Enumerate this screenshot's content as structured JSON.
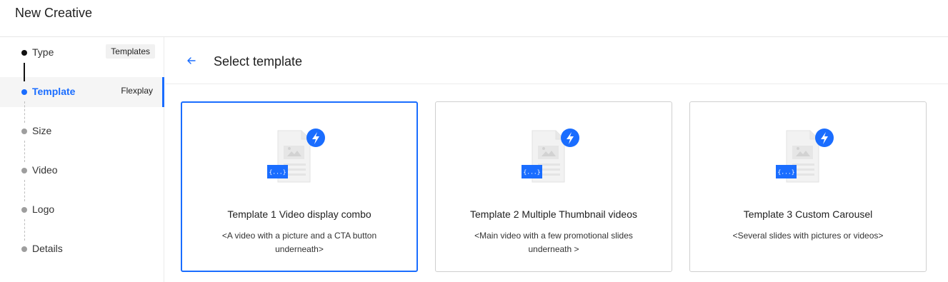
{
  "app": {
    "title": "New Creative"
  },
  "steps": [
    {
      "label": "Type",
      "value": "Templates",
      "state": "done"
    },
    {
      "label": "Template",
      "value": "Flexplay",
      "state": "active"
    },
    {
      "label": "Size",
      "value": "",
      "state": "pending"
    },
    {
      "label": "Video",
      "value": "",
      "state": "pending"
    },
    {
      "label": "Logo",
      "value": "",
      "state": "pending"
    },
    {
      "label": "Details",
      "value": "",
      "state": "pending"
    }
  ],
  "main": {
    "title": "Select template",
    "back_icon": "arrow-left-icon"
  },
  "templates": [
    {
      "title": "Template 1 Video display combo",
      "description": "<A video with a picture and a CTA button underneath>",
      "selected": true,
      "badge_icon": "lightning-icon",
      "code_label": "{...}"
    },
    {
      "title": "Template 2 Multiple Thumbnail videos",
      "description": "<Main video with a few promotional slides underneath >",
      "selected": false,
      "badge_icon": "lightning-icon",
      "code_label": "{...}"
    },
    {
      "title": "Template 3 Custom Carousel",
      "description": "<Several slides with pictures or videos>",
      "selected": false,
      "badge_icon": "lightning-icon",
      "code_label": "{...}"
    }
  ],
  "colors": {
    "accent": "#1a6dff",
    "border": "#cfcfcf",
    "active_bg": "#f5f5f5"
  }
}
